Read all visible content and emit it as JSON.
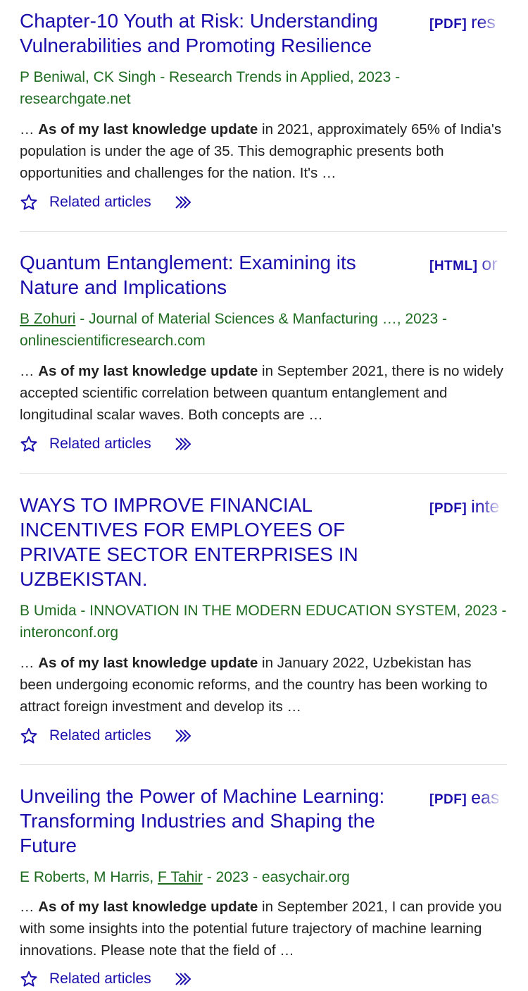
{
  "results": [
    {
      "title": "Chapter-10 Youth at Risk: Understanding Vulnerabilities and Promoting Resilience",
      "doc_type": "[PDF]",
      "doc_host": "res",
      "meta_before": "P Beniwal, CK Singh - Research Trends in Applied, 2023 - researchgate.net",
      "snippet_prefix": "… ",
      "snippet_bold": "As of my last knowledge update",
      "snippet_rest": " in 2021, approximately 65% of India's population is under the age of 35. This demographic presents both opportunities and challenges for the nation. It's …",
      "related_label": "Related articles"
    },
    {
      "title": "Quantum Entanglement: Examining its Nature and Implications",
      "doc_type": "[HTML]",
      "doc_host": "or",
      "meta_link": "B Zohuri",
      "meta_after": " - Journal of Material Sciences & Manfacturing …, 2023 - onlinescientificresearch.com",
      "snippet_prefix": "… ",
      "snippet_bold": "As of my last knowledge update",
      "snippet_rest": " in September 2021, there is no widely accepted scientific correlation between quantum entanglement and longitudinal scalar waves. Both concepts are …",
      "related_label": "Related articles"
    },
    {
      "title": "WAYS TO IMPROVE FINANCIAL INCENTIVES FOR EMPLOYEES OF PRIVATE SECTOR ENTERPRISES IN UZBEKISTAN.",
      "doc_type": "[PDF]",
      "doc_host": "inte",
      "meta_before": "B Umida - INNOVATION IN THE MODERN EDUCATION SYSTEM, 2023 - interonconf.org",
      "snippet_prefix": "… ",
      "snippet_bold": "As of my last knowledge update",
      "snippet_rest": " in January 2022, Uzbekistan has been undergoing economic reforms, and the country has been working to attract foreign investment and develop its …",
      "related_label": "Related articles"
    },
    {
      "title": "Unveiling the Power of Machine Learning: Transforming Industries and Shaping the Future",
      "doc_type": "[PDF]",
      "doc_host": "eas",
      "meta_before": "E Roberts, M Harris, ",
      "meta_link": "F Tahir",
      "meta_after": " - 2023 - easychair.org",
      "snippet_prefix": "… ",
      "snippet_bold": "As of my last knowledge update",
      "snippet_rest": " in September 2021, I can provide you with some insights into the potential future trajectory of machine learning innovations. Please note that the field of …",
      "related_label": "Related articles"
    }
  ]
}
